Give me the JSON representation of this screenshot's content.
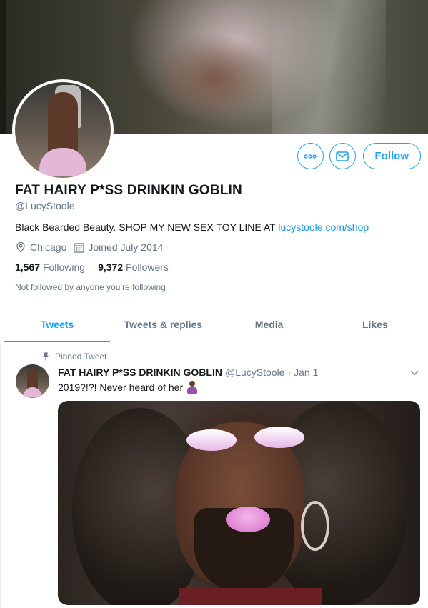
{
  "profile": {
    "name": "FAT HAIRY P*SS DRINKIN GOBLIN",
    "handle": "@LucyStoole",
    "bio_text": "Black Bearded Beauty. SHOP MY NEW SEX TOY LINE AT ",
    "bio_link": "lucystoole.com/shop",
    "location": "Chicago",
    "joined": "Joined July 2014",
    "following_count": "1,567",
    "following_label": "Following",
    "followers_count": "9,372",
    "followers_label": "Followers",
    "followed_note": "Not followed by anyone you’re following"
  },
  "actions": {
    "more_icon": "more-icon",
    "message_icon": "envelope-icon",
    "follow_label": "Follow"
  },
  "tabs": [
    {
      "label": "Tweets",
      "active": true
    },
    {
      "label": "Tweets & replies",
      "active": false
    },
    {
      "label": "Media",
      "active": false
    },
    {
      "label": "Likes",
      "active": false
    }
  ],
  "tweet": {
    "pinned_label": "Pinned Tweet",
    "name": "FAT HAIRY P*SS DRINKIN GOBLIN",
    "handle": "@LucyStoole",
    "separator": "·",
    "date": "Jan 1",
    "text": "2019?!?! Never heard of her",
    "emoji": "person-shrugging-emoji"
  },
  "colors": {
    "accent": "#1da1f2",
    "secondary_text": "#657786",
    "primary_text": "#14171a"
  }
}
